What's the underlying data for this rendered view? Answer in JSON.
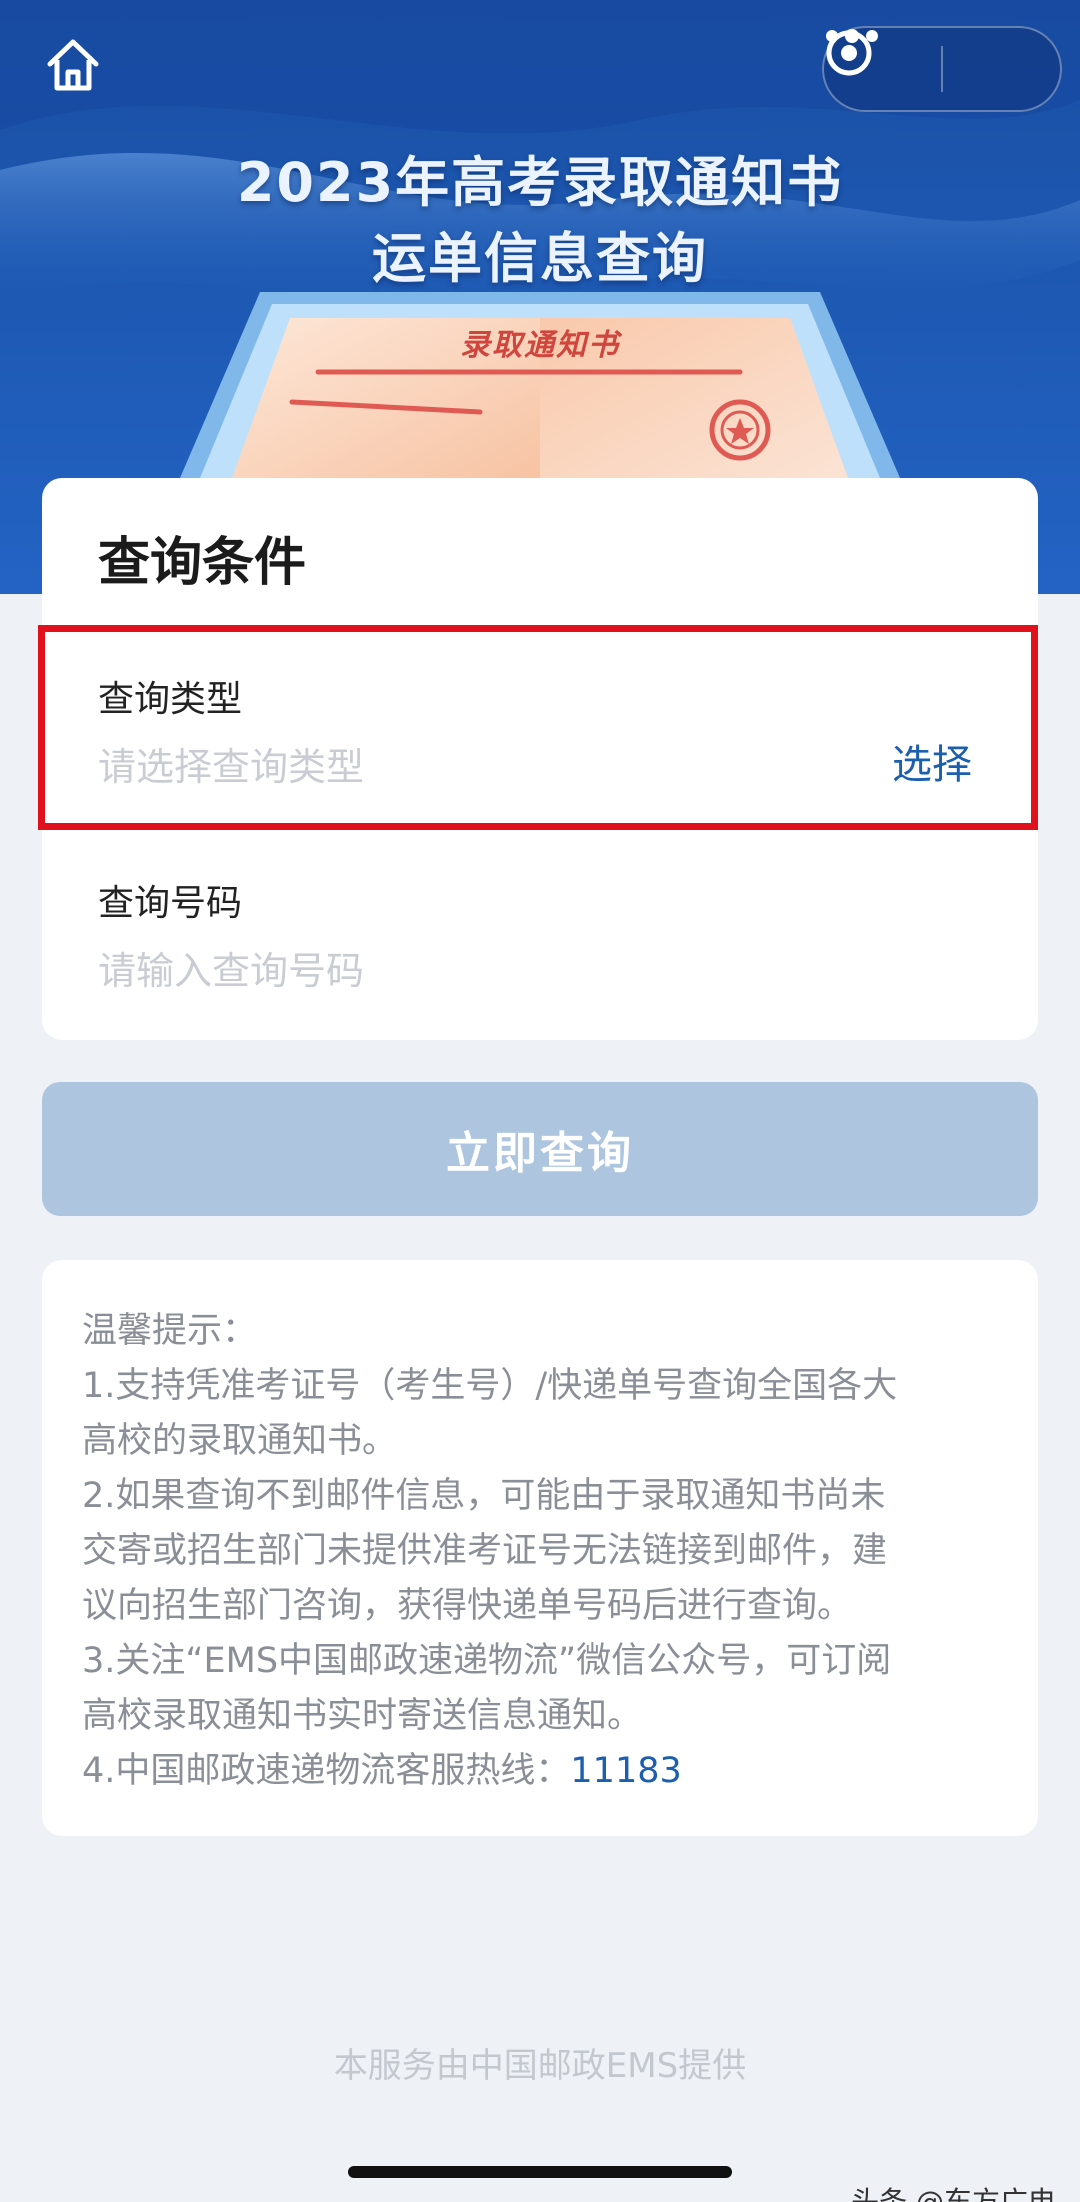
{
  "header": {
    "title_line1": "2023年高考录取通知书",
    "title_line2": "运单信息查询",
    "letter_title": "录取通知书",
    "home_icon": "home-icon",
    "more_icon": "more-dots-icon",
    "close_icon": "target-circle-icon"
  },
  "query_card": {
    "title": "查询条件",
    "type_field": {
      "label": "查询类型",
      "placeholder": "请选择查询类型",
      "action": "选择"
    },
    "number_field": {
      "label": "查询号码",
      "placeholder": "请输入查询号码"
    }
  },
  "submit": {
    "label": "立即查询"
  },
  "tips": {
    "lines": [
      "温馨提示：",
      "1.支持凭准考证号（考生号）/快递单号查询全国各大",
      "高校的录取通知书。",
      "2.如果查询不到邮件信息，可能由于录取通知书尚未",
      "交寄或招生部门未提供准考证号无法链接到邮件，建",
      "议向招生部门咨询，获得快递单号码后进行查询。",
      "3.关注“EMS中国邮政速递物流”微信公众号，可订阅",
      "高校录取通知书实时寄送信息通知。"
    ],
    "hotline_prefix": "4.中国邮政速递物流客服热线：",
    "hotline_number": "11183"
  },
  "footer": {
    "text": "本服务由中国邮政EMS提供"
  },
  "watermark": {
    "text": "头条 @东方广电"
  },
  "colors": {
    "brand_blue": "#1c5fae",
    "banner_blue": "#1e5ab5",
    "highlight_red": "#e0101c",
    "button_disabled": "#adc5df"
  }
}
